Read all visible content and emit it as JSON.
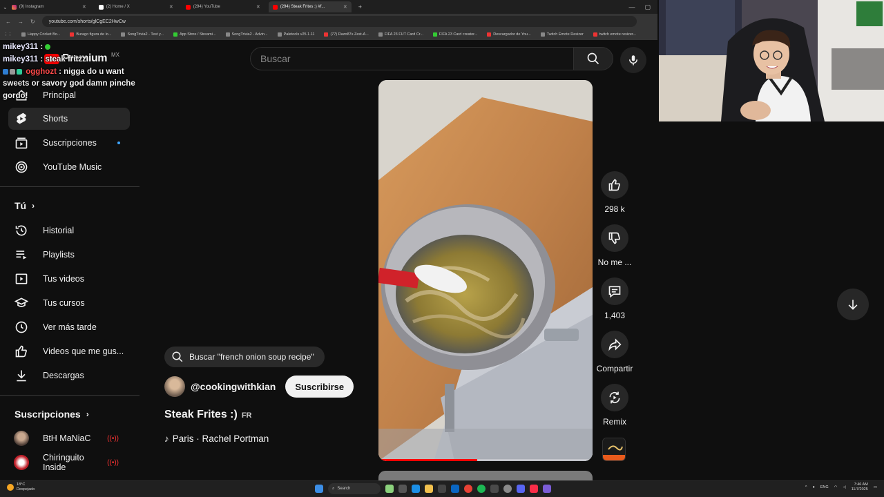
{
  "browser": {
    "tabs": [
      {
        "label": "(9) Instagram",
        "favicon": "instagram-icon",
        "active": false
      },
      {
        "label": "(2) Home / X",
        "favicon": "x-icon",
        "active": false
      },
      {
        "label": "(294) YouTube",
        "favicon": "youtube-icon",
        "active": false
      },
      {
        "label": "(294) Steak Frites :) #f...",
        "favicon": "youtube-icon",
        "active": true
      }
    ],
    "url": "youtube.com/shorts/glCgEC2HwCw",
    "bookmarks": [
      "Happy Cricket Bo...",
      "Burago figura de lo...",
      "SongTrivia2 - Test y...",
      "App Store / Streami...",
      "SongTrivia2 - Advin...",
      "Paletools v25.1.11",
      "(77) Razo87s Zest-A...",
      "FIFA 23 FUT Card Cr...",
      "FIFA 23 Card creator...",
      "Descargador de You...",
      "Twitch Emote Resizer",
      "twitch emote resizer..."
    ]
  },
  "youtube": {
    "logo_text": "Premium",
    "region": "MX",
    "search_placeholder": "Buscar",
    "sidebar": {
      "items": [
        {
          "label": "Principal",
          "icon": "home-icon"
        },
        {
          "label": "Shorts",
          "icon": "shorts-icon"
        },
        {
          "label": "Suscripciones",
          "icon": "subscriptions-icon"
        },
        {
          "label": "YouTube Music",
          "icon": "music-icon"
        }
      ],
      "you_heading": "Tú",
      "you_items": [
        {
          "label": "Historial",
          "icon": "history-icon"
        },
        {
          "label": "Playlists",
          "icon": "playlists-icon"
        },
        {
          "label": "Tus videos",
          "icon": "your-videos-icon"
        },
        {
          "label": "Tus cursos",
          "icon": "courses-icon"
        },
        {
          "label": "Ver más tarde",
          "icon": "watch-later-icon"
        },
        {
          "label": "Videos que me gus...",
          "icon": "thumbs-up-icon"
        },
        {
          "label": "Descargas",
          "icon": "download-icon"
        }
      ],
      "subs_heading": "Suscripciones",
      "subs": [
        {
          "label": "BtH MaNiaC"
        },
        {
          "label": "Chiringuito Inside"
        }
      ]
    },
    "short": {
      "overlay_search": "Buscar \"french onion soup recipe\"",
      "channel": "@cookingwithkian",
      "subscribe_label": "Suscribirse",
      "title": "Steak Frites :)",
      "title_badge": "FR",
      "music": "Paris · Rachel Portman",
      "progress": 0.46,
      "actions": {
        "like_count": "298 k",
        "dislike_label": "No me ...",
        "comments_count": "1,403",
        "share_label": "Compartir",
        "remix_label": "Remix"
      }
    }
  },
  "chat": [
    {
      "user": "mikey311",
      "message": ""
    },
    {
      "user": "mikey311",
      "message": "steak fritzz"
    },
    {
      "user": "ogghozt",
      "message": "nigga do u want sweets or savory god damn pinche gordo!"
    }
  ],
  "taskbar": {
    "weather_temp": "18°C",
    "weather_desc": "Despejado",
    "search_label": "Search",
    "lang": "ENG",
    "time": "7:46 AM",
    "date": "11/7/2025"
  }
}
